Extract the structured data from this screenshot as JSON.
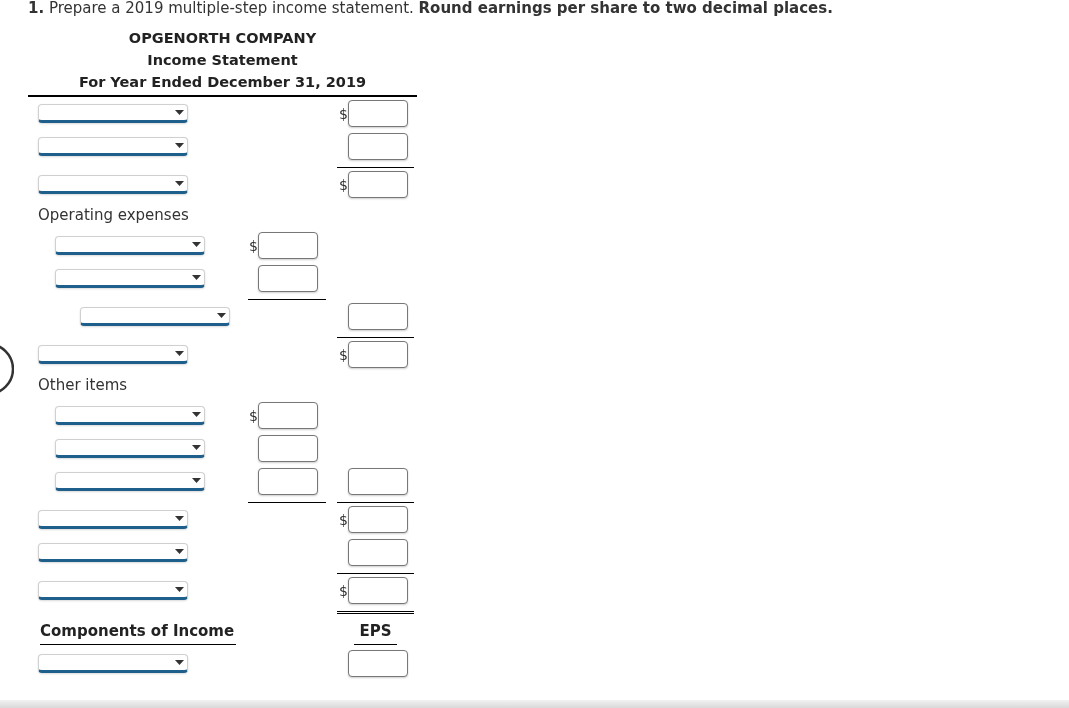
{
  "question": "**1.** Prepare a 2019 multiple-step income statement. **Round earnings per share to two decimal places.**",
  "statement_header": {
    "company": "OPGENORTH COMPANY",
    "title": "Income Statement",
    "period": "For Year Ended December 31, 2019"
  },
  "rows": [
    {
      "kind": "select",
      "column_2": {
        "prefix": "$",
        "rule_below": false,
        "double_rule": false
      }
    },
    {
      "kind": "select",
      "column_2": {
        "rule_below": true,
        "double_rule": false
      }
    },
    {
      "kind": "select",
      "column_2": {
        "prefix": "$",
        "rule_below": false,
        "double_rule": false
      }
    },
    {
      "kind": "label",
      "text": "Operating expenses",
      "children": [
        {
          "kind": "select",
          "column_1": {
            "prefix": "$",
            "rule_below": false,
            "double_rule": false
          }
        },
        {
          "kind": "select",
          "column_1": {
            "rule_below": true,
            "double_rule": false
          }
        },
        {
          "kind": "total_select",
          "column_2": {
            "rule_below": true,
            "double_rule": false
          }
        }
      ]
    },
    {
      "kind": "select",
      "column_2": {
        "prefix": "$",
        "rule_below": false,
        "double_rule": false
      }
    },
    {
      "kind": "label",
      "text": "Other items",
      "children": [
        {
          "kind": "select",
          "column_1": {
            "prefix": "$",
            "rule_below": false,
            "double_rule": false
          }
        },
        {
          "kind": "select",
          "column_1": {
            "rule_below": false,
            "double_rule": false
          }
        },
        {
          "kind": "select",
          "column_1": {
            "rule_below": true,
            "double_rule": false
          },
          "column_2": {
            "rule_below": true,
            "double_rule": false
          }
        }
      ]
    },
    {
      "kind": "select",
      "column_2": {
        "prefix": "$",
        "rule_below": false,
        "double_rule": false
      }
    },
    {
      "kind": "select",
      "column_2": {
        "rule_below": true,
        "double_rule": false
      }
    },
    {
      "kind": "select",
      "column_2": {
        "prefix": "$",
        "rule_below": false,
        "double_rule": true
      }
    },
    {
      "kind": "heading",
      "text": "Components of Income",
      "column_2": {
        "heading": "EPS"
      }
    },
    {
      "kind": "select",
      "column_2": {
        "rule_below": false,
        "double_rule": false
      }
    }
  ]
}
